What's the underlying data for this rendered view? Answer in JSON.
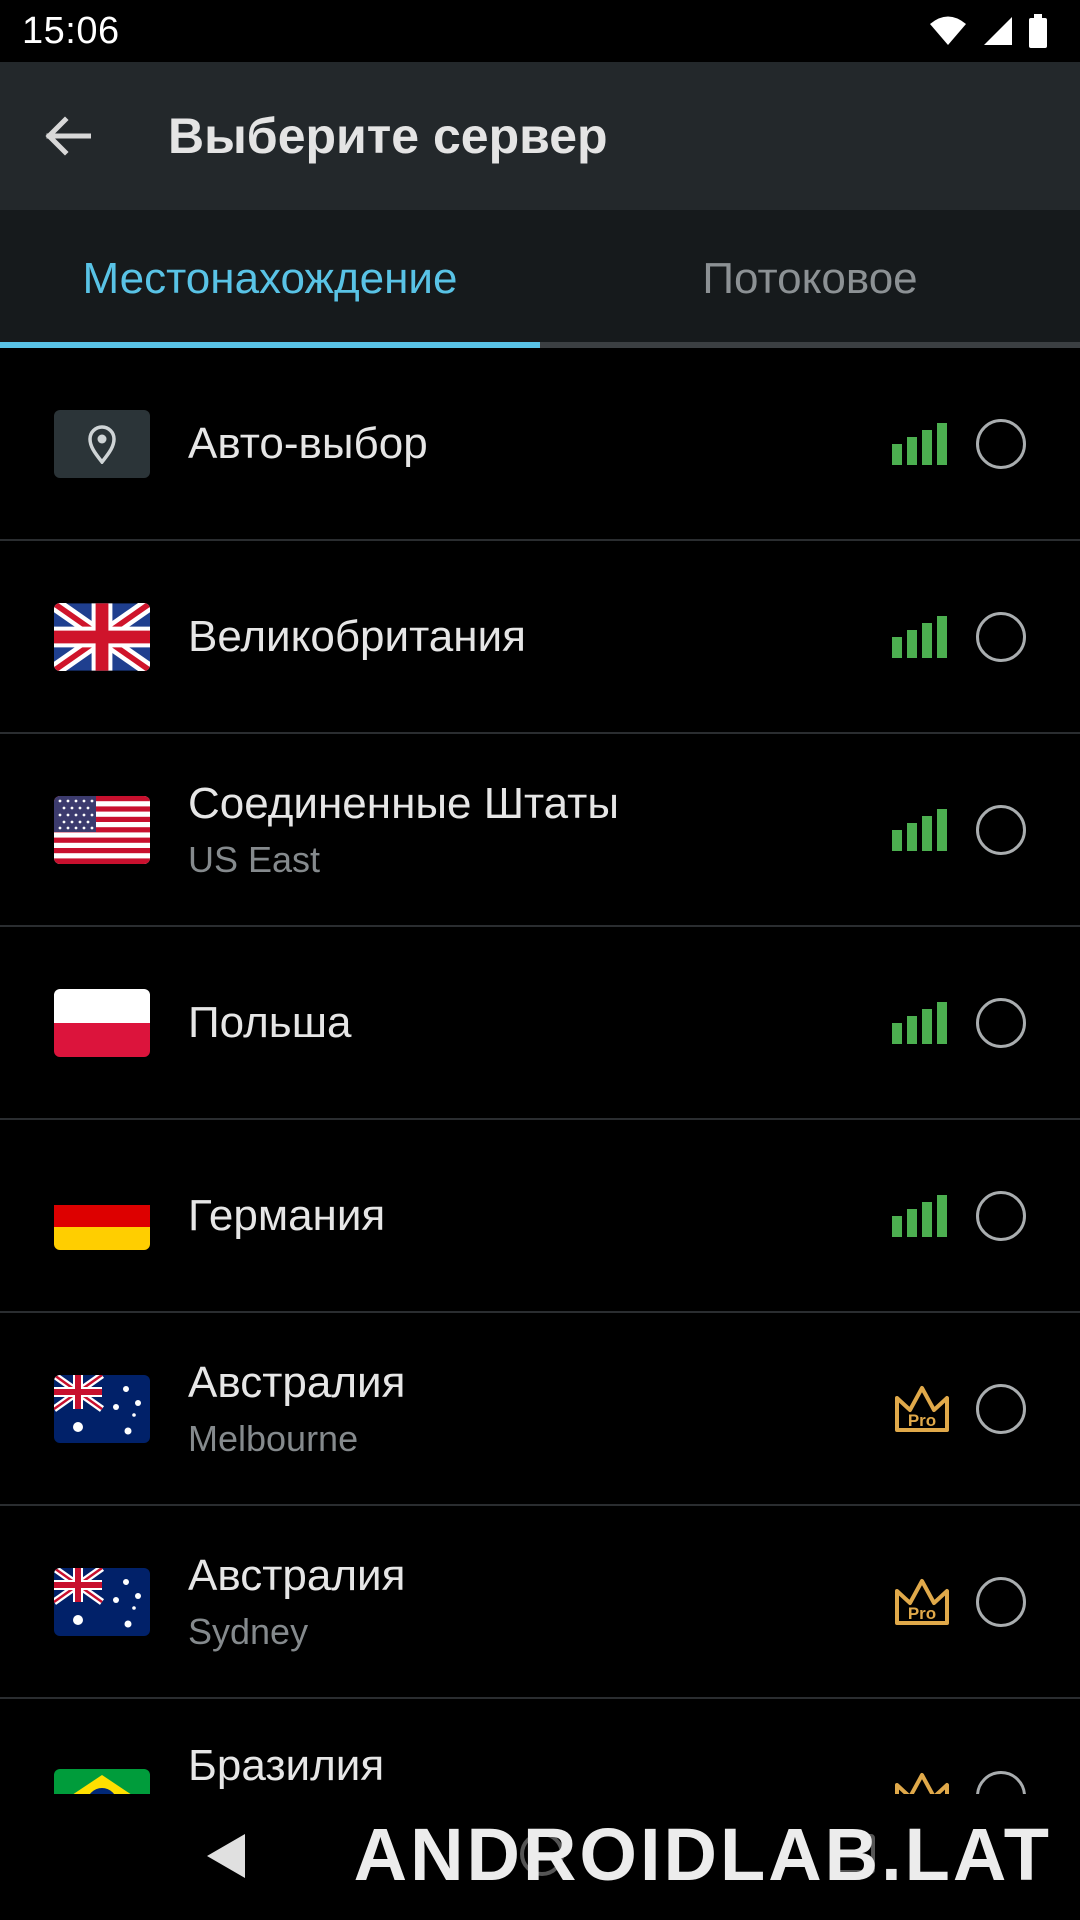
{
  "status_bar": {
    "time": "15:06"
  },
  "app_bar": {
    "title": "Выберите сервер"
  },
  "tabs": [
    {
      "label": "Местонахождение",
      "active": true
    },
    {
      "label": "Потоковое",
      "active": false
    }
  ],
  "servers": [
    {
      "title": "Авто-выбор",
      "subtitle": "",
      "flag": "auto-location-icon",
      "badge": "signal"
    },
    {
      "title": "Великобритания",
      "subtitle": "",
      "flag": "flag-uk-icon",
      "badge": "signal"
    },
    {
      "title": "Соединенные Штаты",
      "subtitle": "US East",
      "flag": "flag-us-icon",
      "badge": "signal"
    },
    {
      "title": "Польша",
      "subtitle": "",
      "flag": "flag-pl-icon",
      "badge": "signal"
    },
    {
      "title": "Германия",
      "subtitle": "",
      "flag": "flag-de-icon",
      "badge": "signal"
    },
    {
      "title": "Австралия",
      "subtitle": "Melbourne",
      "flag": "flag-au-icon",
      "badge": "pro"
    },
    {
      "title": "Австралия",
      "subtitle": "Sydney",
      "flag": "flag-au-icon",
      "badge": "pro"
    },
    {
      "title": "Бразилия",
      "subtitle": "",
      "flag": "flag-br-icon",
      "badge": "pro"
    }
  ],
  "pro_label": "Pro",
  "watermark": "ANDROIDLAB.LAT",
  "colors": {
    "accent": "#59c3e6",
    "signal": "#4caf50",
    "pro": "#e0a94a",
    "app_bar": "#23282b",
    "background": "#000000"
  }
}
